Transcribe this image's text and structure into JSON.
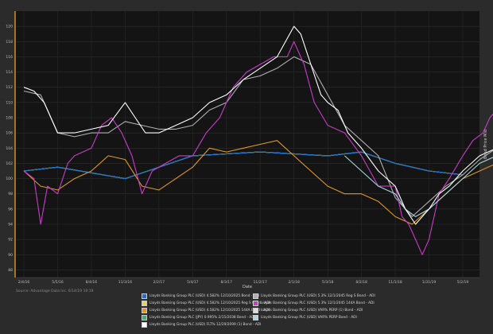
{
  "chart_data": {
    "type": "line",
    "title": "",
    "xlabel": "Date",
    "ylabel": "Bond Price Mid",
    "ylim": [
      87,
      122
    ],
    "yticks": [
      88,
      90,
      92,
      94,
      96,
      98,
      100,
      102,
      104,
      106,
      108,
      110,
      112,
      114,
      116,
      118,
      120
    ],
    "xticks": [
      "2/4/16",
      "5/5/16",
      "8/4/16",
      "11/3/16",
      "2/2/17",
      "5/4/17",
      "8/3/17",
      "11/2/17",
      "2/1/18",
      "5/3/18",
      "8/2/18",
      "11/1/18",
      "1/31/19",
      "5/2/19"
    ],
    "grid": true,
    "legend_position": "bottom",
    "source": "Source: Advantage Data Inc. 6/14/19 10:19",
    "series": [
      {
        "name": "Lloyds Banking Group PLC (USD) 4.582% 12/10/2025 Bond - ADI",
        "color": "#1e6fd9",
        "x": [
          0,
          1,
          3,
          5,
          7,
          9,
          10,
          11,
          12,
          13
        ],
        "y": [
          101,
          101.5,
          100,
          103,
          103.5,
          103,
          103.5,
          102,
          101,
          100.5
        ]
      },
      {
        "name": "Lloyds Banking Group PLC (USD) 5.3% 12/1/2045 Reg S Bond - ADI",
        "color": "#b0b0b0",
        "x": [
          0,
          0.5,
          1,
          1.5,
          2,
          2.5,
          3,
          3.5,
          4,
          4.5,
          5,
          5.5,
          6,
          6.5,
          7,
          7.5,
          8,
          8.5,
          9,
          9.5,
          10,
          10.5,
          11,
          11.5,
          12,
          12.5,
          13,
          13.5,
          14
        ],
        "y": [
          111.5,
          111,
          106,
          105.5,
          106,
          106,
          107.5,
          107,
          106.5,
          106.5,
          107,
          109,
          110,
          113,
          113.5,
          114.5,
          116,
          115,
          111,
          107,
          105,
          103,
          97.5,
          95,
          97,
          99,
          100.5,
          102.5,
          104
        ]
      },
      {
        "name": "Lloyds Banking Group PLC (USD) 4.582% 12/10/2025 Reg S Bond - ADI",
        "color": "#e8d838",
        "x": [
          0,
          1,
          3,
          5,
          7,
          9,
          10,
          11,
          12,
          13
        ],
        "y": [
          101,
          101.5,
          100,
          103,
          103.5,
          103,
          103.5,
          102,
          101,
          100.5
        ]
      },
      {
        "name": "Lloyds Banking Group PLC (USD) 5.3% 12/1/2045 144A Bond - ADI",
        "color": "#c83cc8",
        "x": [
          0,
          0.3,
          0.5,
          0.7,
          1,
          1.3,
          1.5,
          2,
          2.3,
          2.6,
          2.9,
          3.2,
          3.5,
          3.8,
          4.2,
          4.6,
          5,
          5.4,
          5.8,
          6.2,
          6.6,
          7,
          7.4,
          7.8,
          8,
          8.3,
          8.6,
          9,
          9.5,
          10,
          10.5,
          11,
          11.2,
          11.4,
          11.6,
          11.8,
          12,
          12.3,
          12.6,
          13,
          13.3,
          13.6,
          13.8,
          14
        ],
        "y": [
          101,
          100,
          94,
          99,
          98,
          102,
          103,
          104,
          107,
          108,
          106,
          103,
          98,
          101,
          102,
          103,
          103,
          106,
          108,
          112,
          114,
          115,
          116,
          116,
          118,
          115,
          110,
          107,
          106,
          103,
          99,
          99,
          95,
          94,
          92,
          90,
          92,
          98,
          100,
          103,
          105,
          106,
          108,
          109
        ]
      },
      {
        "name": "Lloyds Banking Group PLC (USD) 4.582% 12/10/2025 144A Bond - ADI",
        "color": "#e0962a",
        "x": [
          0,
          0.5,
          1,
          1.5,
          2,
          2.5,
          3,
          3.5,
          4,
          4.5,
          5,
          5.5,
          6,
          6.5,
          7,
          7.5,
          8,
          8.5,
          9,
          9.5,
          10,
          10.5,
          11,
          11.5,
          12,
          12.5,
          13,
          13.5,
          14
        ],
        "y": [
          101,
          99,
          98.5,
          100,
          101,
          103,
          102.5,
          99,
          98.5,
          100,
          101.5,
          104,
          103.5,
          104,
          104.5,
          105,
          103,
          101,
          99,
          98,
          98,
          97,
          95,
          94,
          96,
          98,
          100,
          101,
          102
        ]
      },
      {
        "name": "Lloyds Banking Group PLC (USD) VAR% PERP (1) Bond - ADI",
        "color": "#dcdcdc",
        "x": [
          0,
          1,
          3,
          5,
          7,
          9,
          10,
          11,
          12,
          13
        ],
        "y": [
          101,
          101.5,
          100,
          103,
          103.5,
          103,
          103.5,
          102,
          101,
          100.5
        ]
      },
      {
        "name": "Lloyds Banking Group PLC (JPY) 0.995% 2/15/2038 Bond - ADI",
        "color": "#2ab86a",
        "x": [
          0,
          1,
          3,
          5,
          7,
          9,
          10,
          11,
          12,
          13
        ],
        "y": [
          101,
          101.5,
          100,
          103,
          103.5,
          103,
          103.5,
          102,
          101,
          100.5
        ]
      },
      {
        "name": "Lloyds Banking Group PLC (USD) VAR% PERP Bond - ADI",
        "color": "#a8d8e0",
        "x": [
          9.5,
          10,
          10.5,
          11,
          11.3,
          11.6,
          12,
          12.5,
          13,
          13.5,
          14
        ],
        "y": [
          103,
          101,
          99,
          98,
          96,
          95,
          96,
          98,
          100,
          102,
          103
        ]
      },
      {
        "name": "Lloyds Banking Group PLC (USD) FLT% 12/29/2099 (1) Bond - ADI",
        "color": "#ffffff",
        "x": [
          0,
          0.3,
          0.6,
          1,
          1.5,
          2,
          2.5,
          3,
          3.3,
          3.6,
          4,
          4.5,
          5,
          5.5,
          6,
          6.5,
          7,
          7.5,
          8,
          8.2,
          8.5,
          8.8,
          9,
          9.3,
          9.6,
          10,
          10.5,
          11,
          11.3,
          11.6,
          12,
          12.3,
          12.6,
          13,
          13.5,
          14
        ],
        "y": [
          112,
          111.5,
          110,
          106,
          106,
          106.5,
          107,
          110,
          108,
          106,
          106,
          107,
          108,
          110,
          111,
          113,
          114.5,
          116,
          120,
          119,
          115,
          111,
          110,
          109,
          106,
          104,
          101,
          99,
          96,
          94,
          96,
          98,
          99,
          101,
          103,
          104
        ]
      }
    ]
  }
}
